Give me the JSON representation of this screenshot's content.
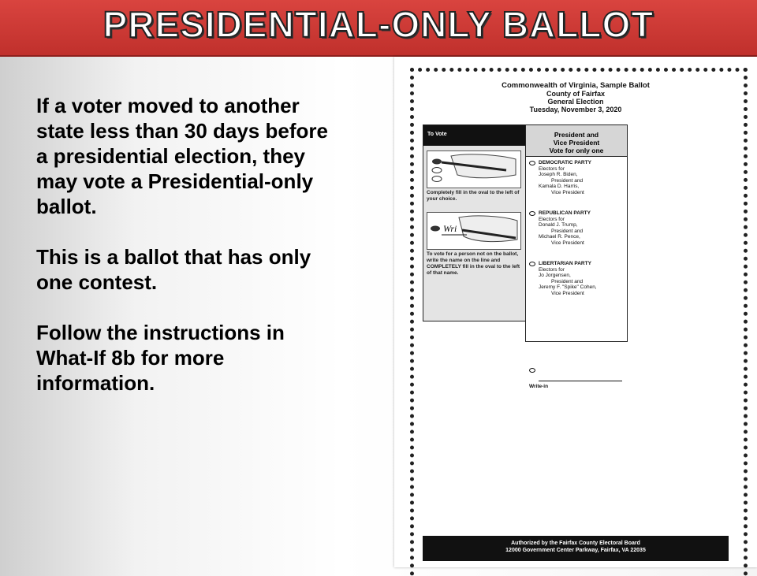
{
  "title": "PRESIDENTIAL-ONLY BALLOT",
  "body": {
    "p1": "If a voter moved to another state less than 30 days before a presidential election, they may vote a Presidential-only ballot.",
    "p2": "This is a ballot that has only one contest.",
    "p3": "Follow the instructions in What-If 8b for more information."
  },
  "ballot": {
    "header": {
      "line1": "Commonwealth of Virginia, Sample Ballot",
      "line2": "County of Fairfax",
      "line3": "General Election",
      "line4": "Tuesday, November 3, 2020"
    },
    "instructions": {
      "head": "To Vote",
      "step1": "Completely fill in the oval to the left of your choice.",
      "step2": "To vote for a person not on the ballot, write the name on the line and COMPLETELY fill in the oval to the left of that name.",
      "write_sample": "Wri"
    },
    "contest": {
      "title1": "President and",
      "title2": "Vice President",
      "title3": "Vote for only one",
      "candidates": [
        {
          "party": "DEMOCRATIC PARTY",
          "electors": "Electors for",
          "pres": "Joseph R. Biden,",
          "pres_role": "President and",
          "vp": "Kamala D. Harris,",
          "vp_role": "Vice President"
        },
        {
          "party": "REPUBLICAN PARTY",
          "electors": "Electors for",
          "pres": "Donald J. Trump,",
          "pres_role": "President and",
          "vp": "Michael R. Pence,",
          "vp_role": "Vice President"
        },
        {
          "party": "LIBERTARIAN PARTY",
          "electors": "Electors for",
          "pres": "Jo Jorgensen,",
          "pres_role": "President and",
          "vp": "Jeremy F. \"Spike\" Cohen,",
          "vp_role": "Vice President"
        }
      ],
      "writein_label": "Write-in"
    },
    "footer": {
      "line1": "Authorized by the Fairfax County Electoral Board",
      "line2": "12000 Government Center Parkway, Fairfax, VA 22035"
    }
  }
}
